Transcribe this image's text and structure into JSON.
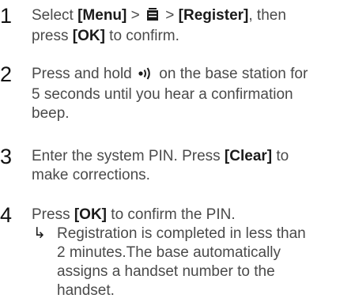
{
  "steps": [
    {
      "num": "1",
      "parts": {
        "a": "Select ",
        "menu": "[Menu]",
        "gt1": " > ",
        "icon": "phonebook-icon",
        "gt2": " > ",
        "register": "[Register]",
        "b": ", then",
        "line2a": "press ",
        "ok": "[OK]",
        "line2b": " to confirm."
      }
    },
    {
      "num": "2",
      "parts": {
        "a": "Press and hold ",
        "icon": "paging-icon",
        "b": " on the base station for",
        "line2": "5 seconds until you hear a confirmation",
        "line3": "beep."
      }
    },
    {
      "num": "3",
      "parts": {
        "a": "Enter the system PIN. Press ",
        "clear": "[Clear]",
        "b": " to",
        "line2": "make corrections."
      }
    },
    {
      "num": "4",
      "parts": {
        "a": "Press ",
        "ok": "[OK]",
        "b": " to confirm the PIN.",
        "arrow": "↳",
        "result1": "Registration is completed in less than",
        "result2": "2 minutes.The base automatically",
        "result3": "assigns a handset number to the",
        "result4": "handset."
      }
    }
  ]
}
